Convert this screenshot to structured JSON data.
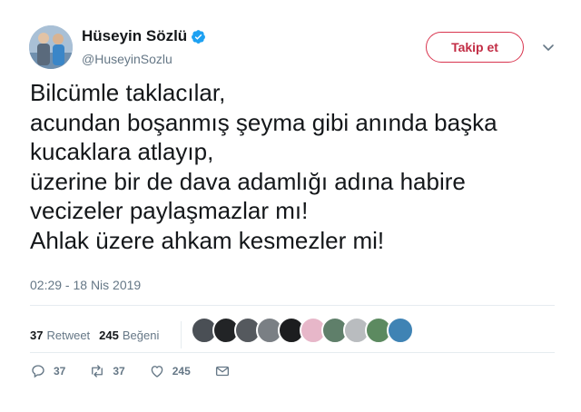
{
  "user": {
    "display_name": "Hüseyin Sözlü",
    "handle": "@HuseyinSozlu",
    "verified": true
  },
  "follow_button": {
    "label": "Takip et"
  },
  "tweet": {
    "lines": [
      "Bilcümle taklacılar,",
      "acundan boşanmış şeyma gibi anında başka",
      "kucaklara atlayıp,",
      "üzerine bir de dava adamlığı adına habire",
      "vecizeler paylaşmazlar mı!",
      "Ahlak üzere ahkam kesmezler mi!"
    ],
    "timestamp": "02:29 - 18 Nis 2019"
  },
  "stats": {
    "retweets": {
      "count": "37",
      "label": "Retweet"
    },
    "likes": {
      "count": "245",
      "label": "Beğeni"
    }
  },
  "likers": [
    "liker-1",
    "liker-2",
    "liker-3",
    "liker-4",
    "liker-5",
    "liker-6",
    "liker-7",
    "liker-8",
    "liker-9"
  ],
  "actions": {
    "reply_count": "37",
    "retweet_count": "37",
    "like_count": "245"
  },
  "colors": {
    "accent": "#c22d45",
    "verified": "#1da1f2",
    "muted": "#657786"
  }
}
